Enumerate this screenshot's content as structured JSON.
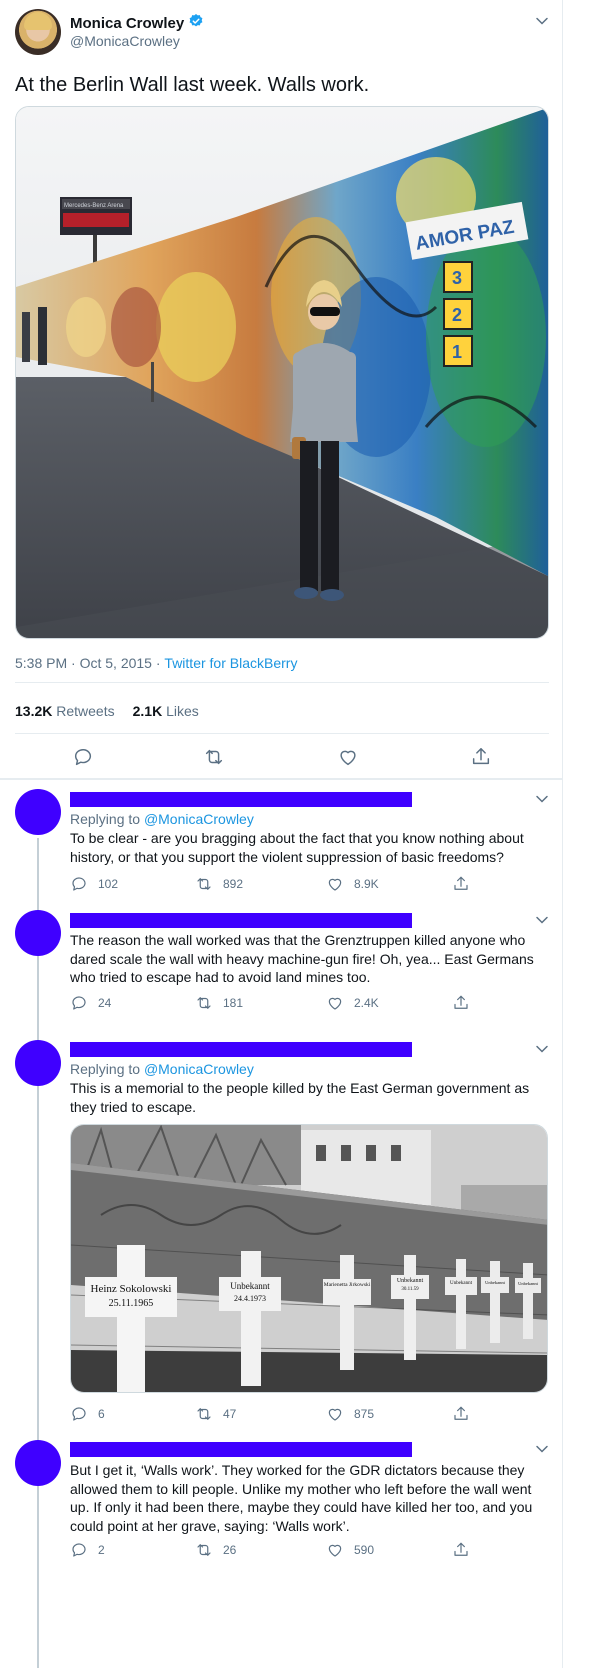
{
  "main_tweet": {
    "display_name": "Monica Crowley",
    "handle": "@MonicaCrowley",
    "text": "At the Berlin Wall last week. Walls work.",
    "photo_text": {
      "billboard": "Mercedes-Benz Arena",
      "graffiti_amor": "AMOR PAZ",
      "graffiti_numbers": [
        "3",
        "2",
        "1"
      ]
    },
    "timestamp": "5:38 PM · Oct 5, 2015",
    "separator": " · ",
    "source": "Twitter for BlackBerry",
    "stats": {
      "retweets_count": "13.2K",
      "retweets_label": "Retweets",
      "likes_count": "2.1K",
      "likes_label": "Likes"
    }
  },
  "replies": [
    {
      "replying_prefix": "Replying to",
      "replying_handle": "@MonicaCrowley",
      "text": "To be clear - are you bragging about the fact that you know nothing about history, or that you support the violent suppression of basic freedoms?",
      "replies": "102",
      "retweets": "892",
      "likes": "8.9K"
    },
    {
      "text": "The reason the wall worked was that the Grenztruppen killed anyone who dared scale the wall with heavy machine-gun fire! Oh, yea... East Germans who tried to escape had to avoid land mines too.",
      "replies": "24",
      "retweets": "181",
      "likes": "2.4K"
    },
    {
      "replying_prefix": "Replying to",
      "replying_handle": "@MonicaCrowley",
      "text": "This is a memorial to the people killed by the East German government as they tried to escape.",
      "crosses": [
        {
          "name": "Heinz Sokolowski",
          "date": "25.11.1965"
        },
        {
          "name": "Unbekannt",
          "date": "24.4.1973"
        },
        {
          "name": "Marienetta Jirkowski",
          "date": ""
        },
        {
          "name": "Unbekannt",
          "date": "30.11.59"
        },
        {
          "name": "Unbekannt",
          "date": ""
        },
        {
          "name": "Unbekannt",
          "date": ""
        },
        {
          "name": "Unbekannt",
          "date": ""
        }
      ],
      "replies": "6",
      "retweets": "47",
      "likes": "875"
    },
    {
      "text": "But I get it, ‘Walls work’. They worked for the GDR dictators because they allowed them to kill people. Unlike my mother who left before the wall went up. If only it had been there, maybe they could have killed her too, and you could point at her grave, saying: ‘Walls work’.",
      "replies": "2",
      "retweets": "26",
      "likes": "590"
    }
  ],
  "colors": {
    "redaction": "#3f00ff",
    "link": "#1b95e0",
    "verified": "#1da1f2",
    "muted": "#5b7083"
  }
}
